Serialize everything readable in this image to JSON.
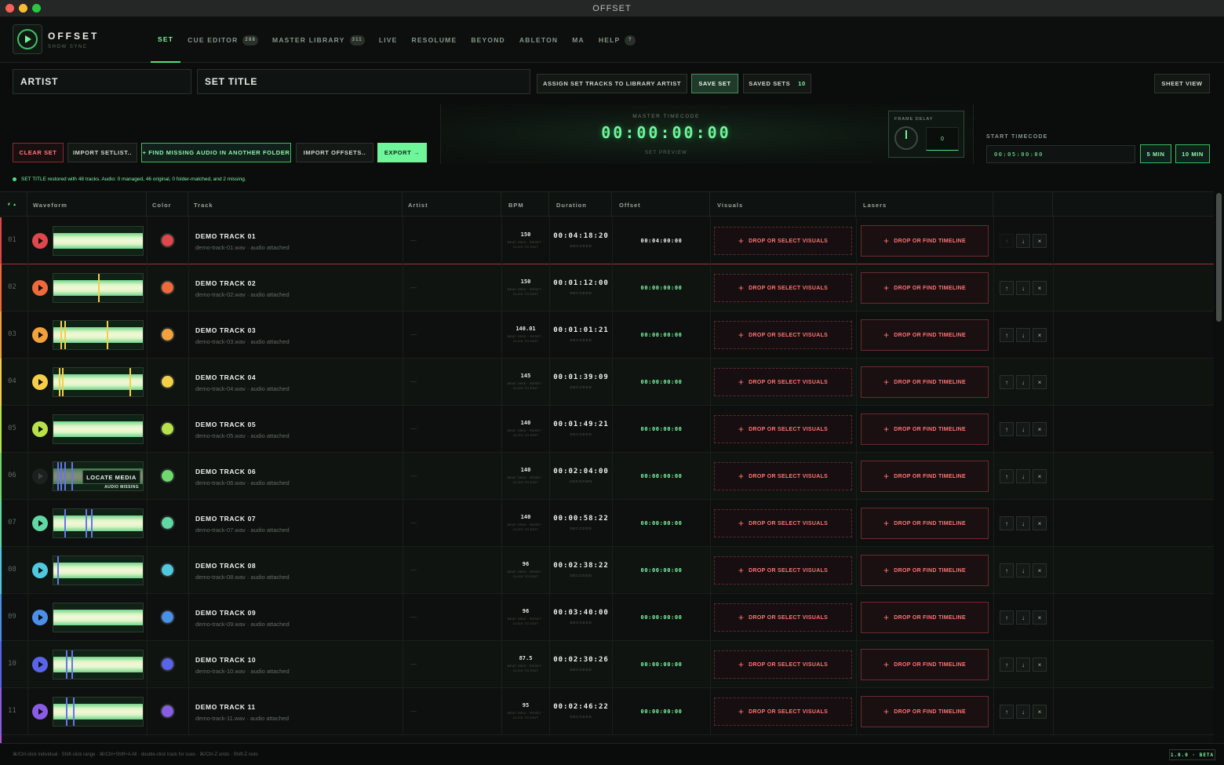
{
  "window": {
    "title": "OFFSET"
  },
  "brand": {
    "name": "OFFSET",
    "subtitle": "SHOW SYNC"
  },
  "nav": [
    {
      "label": "SET",
      "badge": null,
      "active": true
    },
    {
      "label": "CUE EDITOR",
      "badge": "288",
      "active": false
    },
    {
      "label": "MASTER LIBRARY",
      "badge": "311",
      "active": false
    },
    {
      "label": "LIVE",
      "badge": null,
      "active": false
    },
    {
      "label": "RESOLUME",
      "badge": null,
      "active": false
    },
    {
      "label": "BEYOND",
      "badge": null,
      "active": false
    },
    {
      "label": "ABLETON",
      "badge": null,
      "active": false
    },
    {
      "label": "MA",
      "badge": null,
      "active": false
    },
    {
      "label": "HELP",
      "badge": "?",
      "active": false
    }
  ],
  "set": {
    "artist": "ARTIST",
    "title": "SET TITLE",
    "assign_label": "ASSIGN SET TRACKS TO LIBRARY ARTIST",
    "save_label": "SAVE SET",
    "saved_sets_label": "SAVED SETS",
    "saved_sets_count": "10",
    "sheet_view_label": "SHEET VIEW"
  },
  "actions": {
    "clear": "CLEAR SET",
    "import_setlist": "IMPORT SETLIST..",
    "find_missing": "+ FIND MISSING AUDIO IN ANOTHER FOLDER",
    "import_offsets": "IMPORT OFFSETS..",
    "export": "EXPORT →"
  },
  "timecode": {
    "label": "MASTER TIMECODE",
    "value": "00:00:00:00",
    "sub": "SET PREVIEW",
    "frame_delay_label": "FRAME DELAY",
    "frame_delay_value": "0",
    "start_label": "START TIMECODE",
    "start_value": "00:05:00:00",
    "btn_5min": "5 MIN",
    "btn_10min": "10 MIN"
  },
  "status_message": "SET TITLE restored with 48 tracks. Audio: 0 managed, 46 original, 0 folder-matched, and 2 missing.",
  "columns": {
    "sort": "# ▲",
    "waveform": "Waveform",
    "color": "Color",
    "track": "Track",
    "artist": "Artist",
    "bpm": "BPM",
    "duration": "Duration",
    "offset": "Offset",
    "visuals": "Visuals",
    "lasers": "Lasers"
  },
  "row_labels": {
    "bpm_hint": "BEAT GRID · RESET · CLICK TO EDIT",
    "visuals_button": "DROP OR SELECT VISUALS",
    "lasers_button": "DROP OR FIND TIMELINE",
    "plus": "+",
    "up": "↑",
    "down": "↓",
    "remove": "×",
    "locate_media": "LOCATE MEDIA",
    "audio_missing": "AUDIO MISSING",
    "artist_empty": "—"
  },
  "tracks": [
    {
      "num": "01",
      "name": "DEMO TRACK 01",
      "file": "demo-track-01.wav · audio attached",
      "bpm": "150",
      "duration": "00:04:18:20",
      "duration_status": "DECODED",
      "offset": "00:04:00:00",
      "color": "#e0474c",
      "missing": false
    },
    {
      "num": "02",
      "name": "DEMO TRACK 02",
      "file": "demo-track-02.wav · audio attached",
      "bpm": "150",
      "duration": "00:01:12:00",
      "duration_status": "DECODED",
      "offset": "00:00:00:00",
      "color": "#ee6a3b",
      "missing": false
    },
    {
      "num": "03",
      "name": "DEMO TRACK 03",
      "file": "demo-track-03.wav · audio attached",
      "bpm": "140.01",
      "duration": "00:01:01:21",
      "duration_status": "DECODED",
      "offset": "00:00:00:00",
      "color": "#f2a13c",
      "missing": false
    },
    {
      "num": "04",
      "name": "DEMO TRACK 04",
      "file": "demo-track-04.wav · audio attached",
      "bpm": "145",
      "duration": "00:01:39:09",
      "duration_status": "DECODED",
      "offset": "00:00:00:00",
      "color": "#f5cf48",
      "missing": false
    },
    {
      "num": "05",
      "name": "DEMO TRACK 05",
      "file": "demo-track-05.wav · audio attached",
      "bpm": "140",
      "duration": "00:01:49:21",
      "duration_status": "DECODED",
      "offset": "00:00:00:00",
      "color": "#b7e24a",
      "missing": false
    },
    {
      "num": "06",
      "name": "DEMO TRACK 06",
      "file": "demo-track-06.wav · audio attached",
      "bpm": "140",
      "duration": "00:02:04:00",
      "duration_status": "UNKNOWN",
      "offset": "00:00:00:00",
      "color": "#6fd86e",
      "missing": true
    },
    {
      "num": "07",
      "name": "DEMO TRACK 07",
      "file": "demo-track-07.wav · audio attached",
      "bpm": "140",
      "duration": "00:00:58:22",
      "duration_status": "DECODED",
      "offset": "00:00:00:00",
      "color": "#5fd8a3",
      "missing": false
    },
    {
      "num": "08",
      "name": "DEMO TRACK 08",
      "file": "demo-track-08.wav · audio attached",
      "bpm": "96",
      "duration": "00:02:38:22",
      "duration_status": "DECODED",
      "offset": "00:00:00:00",
      "color": "#4ec9df",
      "missing": false
    },
    {
      "num": "09",
      "name": "DEMO TRACK 09",
      "file": "demo-track-09.wav · audio attached",
      "bpm": "96",
      "duration": "00:03:40:00",
      "duration_status": "DECODED",
      "offset": "00:00:00:00",
      "color": "#4a8fe8",
      "missing": false
    },
    {
      "num": "10",
      "name": "DEMO TRACK 10",
      "file": "demo-track-10.wav · audio attached",
      "bpm": "87.5",
      "duration": "00:02:30:26",
      "duration_status": "DECODED",
      "offset": "00:00:00:00",
      "color": "#5a63ec",
      "missing": false
    },
    {
      "num": "11",
      "name": "DEMO TRACK 11",
      "file": "demo-track-11.wav · audio attached",
      "bpm": "95",
      "duration": "00:02:46:22",
      "duration_status": "DECODED",
      "offset": "00:00:00:00",
      "color": "#8a5ce6",
      "missing": false
    }
  ],
  "footer": {
    "hint": "⌘/Ctrl-click individual · Shift-click range · ⌘/Ctrl+Shift+A All · double-click track for cues · ⌘/Ctrl-Z undo · Shift-Z redo",
    "version": "1.0.0 · BETA"
  }
}
